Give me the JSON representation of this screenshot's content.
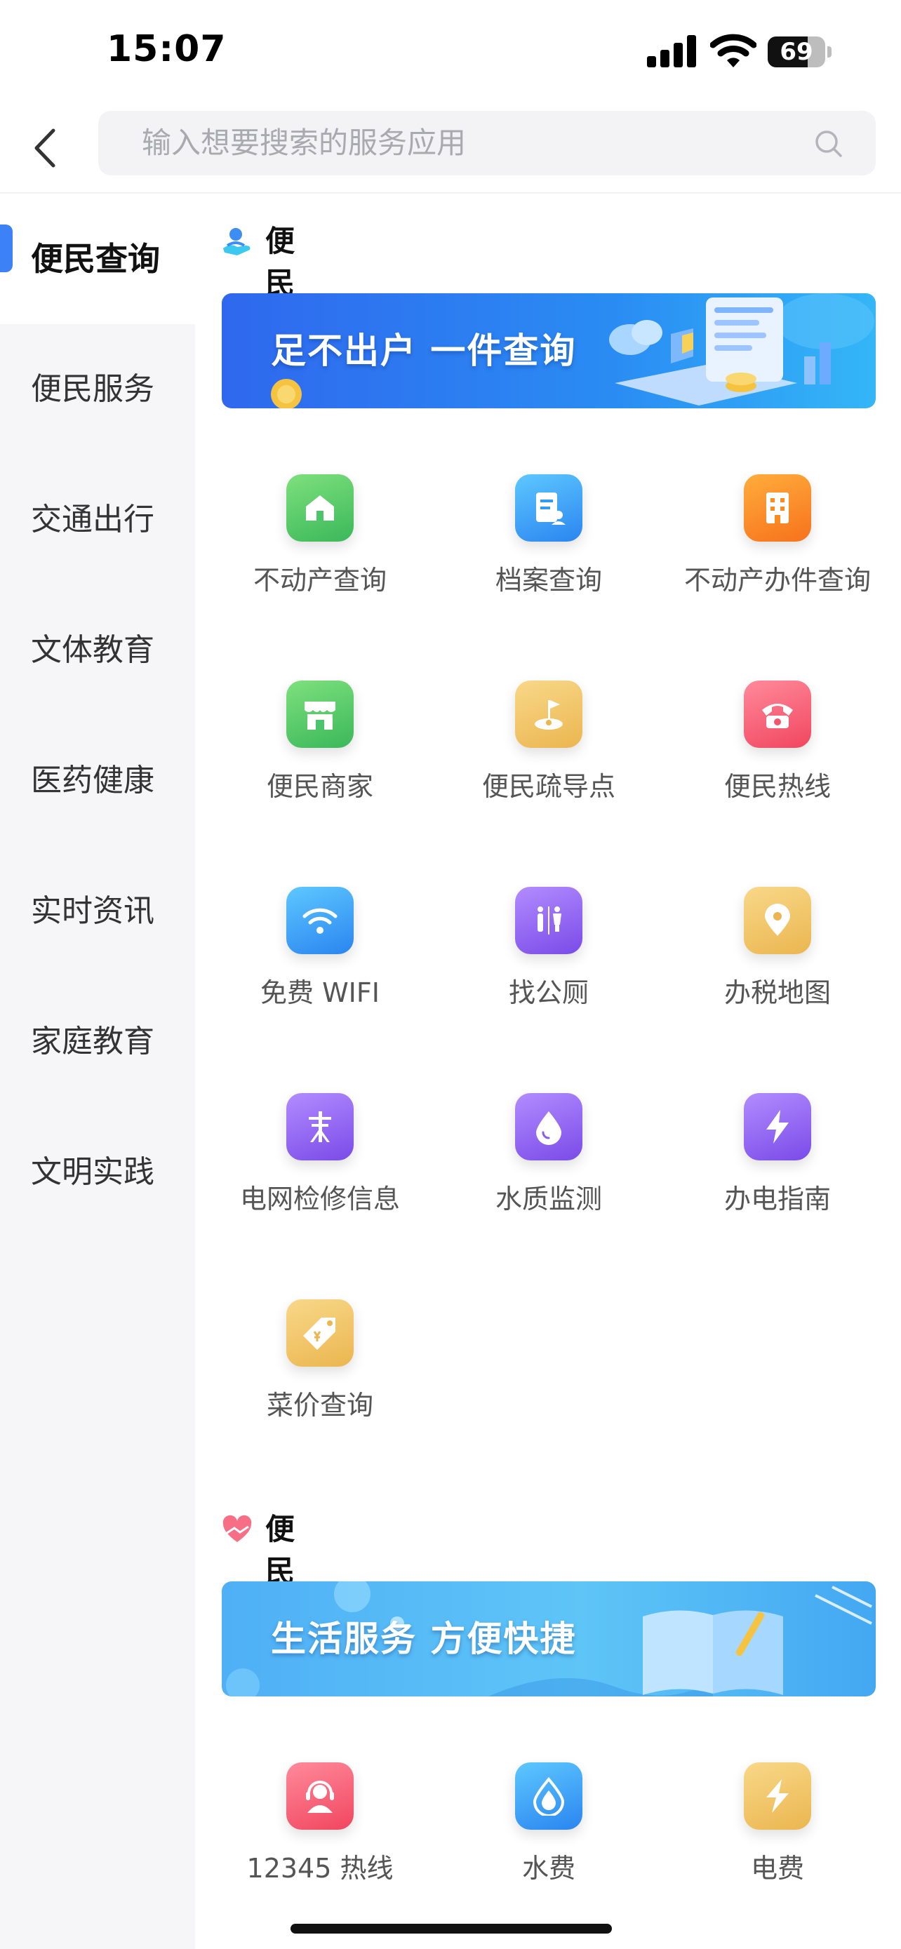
{
  "status_bar": {
    "time": "15:07",
    "battery": "69",
    "battery_level": 0.69
  },
  "search": {
    "placeholder": "输入想要搜索的服务应用"
  },
  "sidebar": {
    "items": [
      {
        "label": "便民查询",
        "active": true
      },
      {
        "label": "便民服务"
      },
      {
        "label": "交通出行"
      },
      {
        "label": "文体教育"
      },
      {
        "label": "医药健康"
      },
      {
        "label": "实时资讯"
      },
      {
        "label": "家庭教育"
      },
      {
        "label": "文明实践"
      }
    ]
  },
  "sections": [
    {
      "title": "便民查询",
      "banner": "足不出户  一件查询",
      "tiles": [
        {
          "label": "不动产查询",
          "icon": "house-icon",
          "color": "#4cc46a"
        },
        {
          "label": "档案查询",
          "icon": "document-icon",
          "color": "#2f9bf5"
        },
        {
          "label": "不动产办件查询",
          "icon": "building-icon",
          "color": "#fb8a1f"
        },
        {
          "label": "便民商家",
          "icon": "store-icon",
          "color": "#4cc46a"
        },
        {
          "label": "便民疏导点",
          "icon": "location-flag-icon",
          "color": "#efc35e"
        },
        {
          "label": "便民热线",
          "icon": "telephone-icon",
          "color": "#f4566e"
        },
        {
          "label": "免费 WIFI",
          "icon": "wifi-icon",
          "color": "#2f9bf5"
        },
        {
          "label": "找公厕",
          "icon": "restroom-icon",
          "color": "#8c5cf0"
        },
        {
          "label": "办税地图",
          "icon": "map-pin-icon",
          "color": "#efc35e"
        },
        {
          "label": "电网检修信息",
          "icon": "power-pole-icon",
          "color": "#8c5cf0"
        },
        {
          "label": "水质监测",
          "icon": "water-drop-icon",
          "color": "#8c5cf0"
        },
        {
          "label": "办电指南",
          "icon": "lightning-icon",
          "color": "#8c5cf0"
        },
        {
          "label": "菜价查询",
          "icon": "price-tag-icon",
          "color": "#efc35e"
        }
      ]
    },
    {
      "title": "便民服务",
      "banner": "生活服务  方便快捷",
      "tiles": [
        {
          "label": "12345 热线",
          "icon": "headset-agent-icon",
          "color": "#f4566e"
        },
        {
          "label": "水费",
          "icon": "water-bill-icon",
          "color": "#2f9bf5"
        },
        {
          "label": "电费",
          "icon": "electricity-bill-icon",
          "color": "#efc35e"
        }
      ]
    }
  ]
}
